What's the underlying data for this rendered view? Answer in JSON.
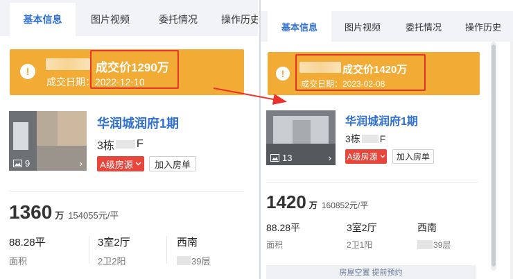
{
  "tabs": [
    "基本信息",
    "图片视频",
    "委托情况",
    "操作历史"
  ],
  "before": {
    "deal_price": "成交价1290万",
    "deal_date": "成交日期：2022-12-10",
    "project_name": "华润城润府1期",
    "building_prefix": "3栋",
    "building_suffix": "F",
    "photo_count": "9",
    "chevron": "›",
    "grade_badge": "A级房源",
    "add_button": "加入房单",
    "total_price": "1360",
    "price_unit": "万",
    "unit_price": "154055元/平",
    "area_value": "88.28平",
    "area_label": "面积",
    "layout_value": "3室2厅",
    "layout_detail": "2卫2阳",
    "orientation_value": "西南",
    "floor_label": "39层"
  },
  "after": {
    "deal_price": "成交价1420万",
    "deal_date": "成交日期：2023-02-08",
    "project_name": "华润城润府1期",
    "building_prefix": "3栋",
    "building_suffix": "F",
    "photo_count": "13",
    "chevron": "›",
    "grade_badge": "A级房源",
    "add_button": "加入房单",
    "total_price": "1420",
    "price_unit": "万",
    "unit_price": "160852元/平",
    "area_value": "88.28平",
    "area_label": "面积",
    "layout_value": "3室2厅",
    "layout_detail": "2卫1阳",
    "orientation_value": "西南",
    "floor_label": "39层",
    "notice": "房屋空置  提前预约"
  },
  "colors": {
    "accent_blue": "#2f6fd1",
    "banner_orange": "#f2ab35",
    "highlight_red": "#e8322b",
    "badge_red": "#e8463b"
  },
  "icons": {
    "warning": "warning-icon",
    "photo": "photo-icon",
    "chevron": "chevron-right-icon",
    "dropdown": "chevron-down-icon",
    "arrow": "red-arrow-icon"
  }
}
